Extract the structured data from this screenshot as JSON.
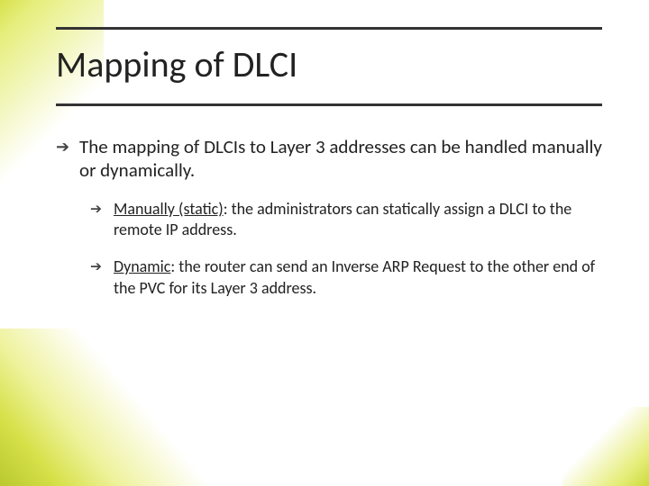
{
  "title": "Mapping of DLCI",
  "arrow_glyph": "➔",
  "bullets": {
    "main": "The mapping of DLCIs to Layer 3 addresses can be handled manually or dynamically.",
    "sub1_lead_space": " ",
    "sub1_term": "Manually (static)",
    "sub1_rest": ": the administrators can statically assign a DLCI to the remote IP address.",
    "sub2_term": "Dynamic",
    "sub2_rest": ": the router can send an Inverse ARP Request to the other end of the PVC for its Layer 3 address."
  }
}
